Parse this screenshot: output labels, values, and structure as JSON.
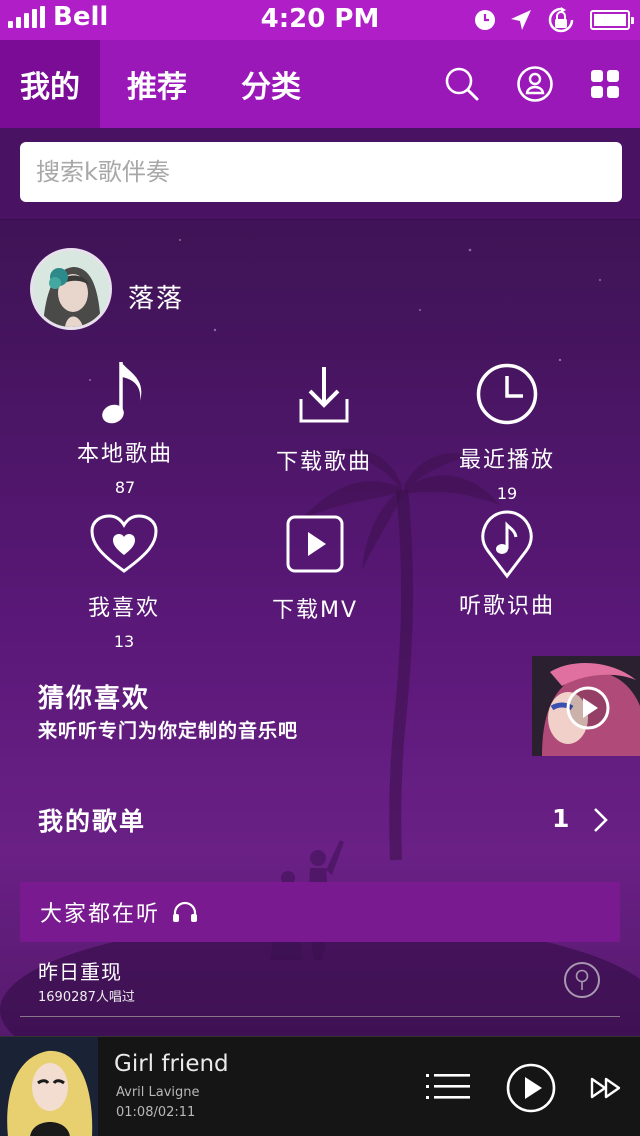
{
  "status_bar": {
    "carrier": "Bell",
    "time": "4:20 PM",
    "icons": [
      "signal-icon",
      "alarm-clock-icon",
      "location-arrow-icon",
      "rotation-lock-icon",
      "battery-icon"
    ]
  },
  "nav": {
    "tabs": [
      {
        "label": "我的",
        "active": true
      },
      {
        "label": "推荐",
        "active": false
      },
      {
        "label": "分类",
        "active": false
      }
    ],
    "icons": [
      "search-icon",
      "user-profile-icon",
      "grid-menu-icon"
    ]
  },
  "search": {
    "placeholder": "搜索k歌伴奏",
    "value": ""
  },
  "profile": {
    "username": "落落"
  },
  "grid": [
    {
      "icon": "music-note-icon",
      "label": "本地歌曲",
      "count": "87"
    },
    {
      "icon": "download-icon",
      "label": "下载歌曲",
      "count": ""
    },
    {
      "icon": "clock-icon",
      "label": "最近播放",
      "count": "19"
    },
    {
      "icon": "heart-icon",
      "label": "我喜欢",
      "count": "13"
    },
    {
      "icon": "play-square-icon",
      "label": "下载MV",
      "count": ""
    },
    {
      "icon": "music-pin-icon",
      "label": "听歌识曲",
      "count": ""
    }
  ],
  "guess": {
    "title": "猜你喜欢",
    "subtitle": "来听听专门为你定制的音乐吧"
  },
  "playlists": {
    "label": "我的歌单",
    "count": "1"
  },
  "listening": {
    "title": "大家都在听",
    "song_title": "昨日重现",
    "song_count": "1690287人唱过"
  },
  "player": {
    "title": "Girl friend",
    "artist": "Avril Lavigne",
    "time": "01:08/02:11"
  },
  "colors": {
    "status_bar": "#b01ec8",
    "nav_bar": "#9a18b8",
    "active_tab": "#7a0c95",
    "listening_bar": "#7a1a90",
    "player_bg": "#151515"
  }
}
